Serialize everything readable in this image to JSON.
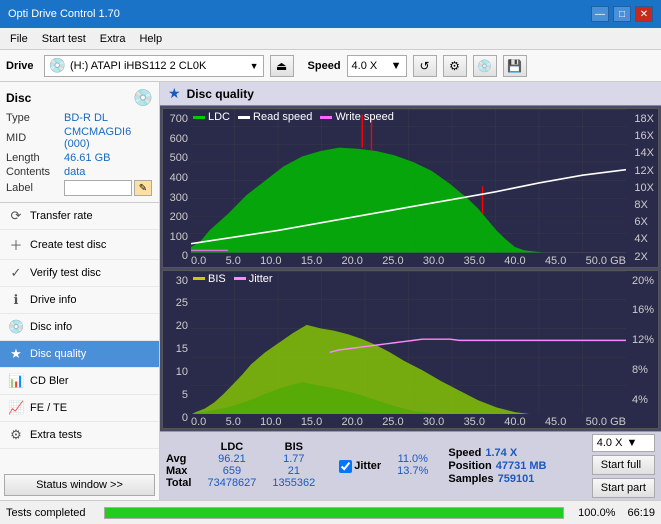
{
  "titlebar": {
    "title": "Opti Drive Control 1.70",
    "btn_min": "—",
    "btn_max": "□",
    "btn_close": "✕"
  },
  "menubar": {
    "items": [
      "File",
      "Start test",
      "Extra",
      "Help"
    ]
  },
  "toolbar": {
    "drive_label": "Drive",
    "drive_value": "(H:) ATAPI iHBS112  2 CL0K",
    "speed_label": "Speed",
    "speed_value": "4.0 X"
  },
  "disc": {
    "title": "Disc",
    "type_label": "Type",
    "type_value": "BD-R DL",
    "mid_label": "MID",
    "mid_value": "CMCMAGDI6 (000)",
    "length_label": "Length",
    "length_value": "46.61 GB",
    "contents_label": "Contents",
    "contents_value": "data",
    "label_label": "Label",
    "label_value": ""
  },
  "nav": {
    "items": [
      {
        "id": "transfer-rate",
        "label": "Transfer rate",
        "icon": "⟳"
      },
      {
        "id": "create-test-disc",
        "label": "Create test disc",
        "icon": "+"
      },
      {
        "id": "verify-test-disc",
        "label": "Verify test disc",
        "icon": "✓"
      },
      {
        "id": "drive-info",
        "label": "Drive info",
        "icon": "ℹ"
      },
      {
        "id": "disc-info",
        "label": "Disc info",
        "icon": "💿"
      },
      {
        "id": "disc-quality",
        "label": "Disc quality",
        "icon": "★",
        "active": true
      },
      {
        "id": "cd-bler",
        "label": "CD Bler",
        "icon": "📊"
      },
      {
        "id": "fe-te",
        "label": "FE / TE",
        "icon": "📈"
      },
      {
        "id": "extra-tests",
        "label": "Extra tests",
        "icon": "⚙"
      }
    ],
    "status_window": "Status window >>"
  },
  "disc_quality": {
    "title": "Disc quality",
    "chart1": {
      "legend": [
        {
          "label": "LDC",
          "color": "#00cc00"
        },
        {
          "label": "Read speed",
          "color": "#ffffff"
        },
        {
          "label": "Write speed",
          "color": "#ff66ff"
        }
      ],
      "y_left": [
        "700",
        "600",
        "500",
        "400",
        "300",
        "200",
        "100",
        "0"
      ],
      "y_right": [
        "18X",
        "16X",
        "14X",
        "12X",
        "10X",
        "8X",
        "6X",
        "4X",
        "2X"
      ],
      "x_labels": [
        "0.0",
        "5.0",
        "10.0",
        "15.0",
        "20.0",
        "25.0",
        "30.0",
        "35.0",
        "40.0",
        "45.0",
        "50.0 GB"
      ]
    },
    "chart2": {
      "legend": [
        {
          "label": "BIS",
          "color": "#cccc00"
        },
        {
          "label": "Jitter",
          "color": "#ff88ff"
        }
      ],
      "y_left": [
        "30",
        "25",
        "20",
        "15",
        "10",
        "5",
        "0"
      ],
      "y_right": [
        "20%",
        "16%",
        "12%",
        "8%",
        "4%"
      ],
      "x_labels": [
        "0.0",
        "5.0",
        "10.0",
        "15.0",
        "20.0",
        "25.0",
        "30.0",
        "35.0",
        "40.0",
        "45.0",
        "50.0 GB"
      ]
    }
  },
  "stats": {
    "ldc_label": "LDC",
    "bis_label": "BIS",
    "jitter_label": "Jitter",
    "jitter_checked": true,
    "speed_label": "Speed",
    "speed_value": "1.74 X",
    "position_label": "Position",
    "position_value": "47731 MB",
    "samples_label": "Samples",
    "samples_value": "759101",
    "avg_label": "Avg",
    "avg_ldc": "96.21",
    "avg_bis": "1.77",
    "avg_jitter": "11.0%",
    "max_label": "Max",
    "max_ldc": "659",
    "max_bis": "21",
    "max_jitter": "13.7%",
    "total_label": "Total",
    "total_ldc": "73478627",
    "total_bis": "1355362",
    "speed_dropdown": "4.0 X",
    "btn_start_full": "Start full",
    "btn_start_part": "Start part"
  },
  "statusbar": {
    "text": "Tests completed",
    "progress": 100,
    "progress_text": "100.0%",
    "time": "66:19"
  }
}
